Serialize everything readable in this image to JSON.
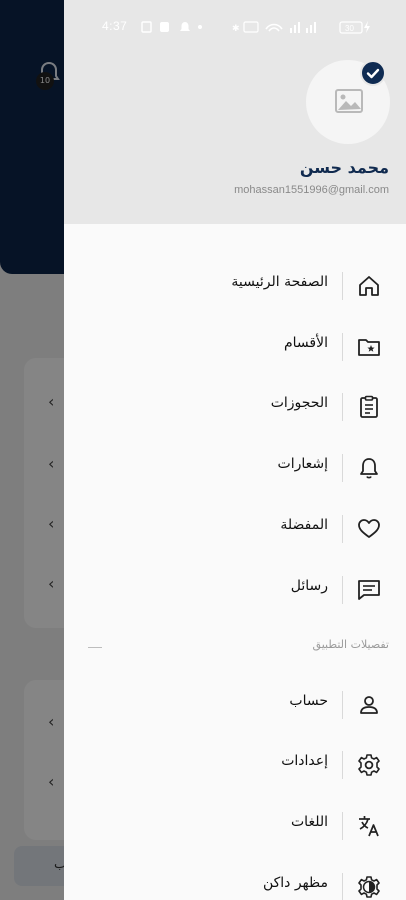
{
  "status_bar": {
    "time": "4:37",
    "battery": "30"
  },
  "background": {
    "badge_count": "10",
    "bottom_button_fragment": "ب"
  },
  "drawer": {
    "user": {
      "name": "محمد حسن",
      "email": "mohassan1551996@gmail.com"
    },
    "menu": [
      {
        "label": "الصفحة الرئيسية",
        "icon": "home-icon"
      },
      {
        "label": "الأقسام",
        "icon": "folder-star-icon"
      },
      {
        "label": "الحجوزات",
        "icon": "clipboard-list-icon"
      },
      {
        "label": "إشعارات",
        "icon": "bell-icon"
      },
      {
        "label": "المفضلة",
        "icon": "heart-icon"
      },
      {
        "label": "رسائل",
        "icon": "message-icon"
      }
    ],
    "settings_section_title": "تفصيلات التطبيق",
    "settings": [
      {
        "label": "حساب",
        "icon": "user-icon"
      },
      {
        "label": "إعدادات",
        "icon": "gear-icon"
      },
      {
        "label": "اللغات",
        "icon": "translate-icon"
      },
      {
        "label": "مظهر داكن",
        "icon": "dark-mode-icon"
      }
    ]
  },
  "colors": {
    "primary": "#0d2649",
    "name_text": "#102a4f",
    "drawer_header": "#e7e7e7"
  }
}
